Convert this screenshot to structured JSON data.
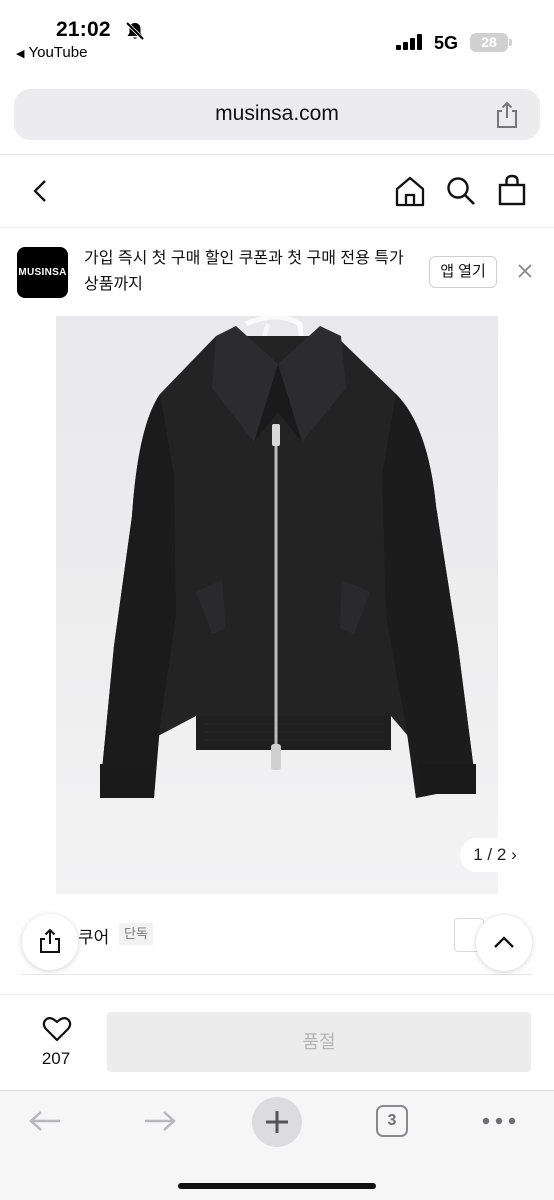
{
  "status_bar": {
    "time": "21:02",
    "back_app": "YouTube",
    "network": "5G",
    "battery": "28",
    "icons": [
      "bell-slash-icon",
      "signal-icon"
    ]
  },
  "browser": {
    "url": "musinsa.com"
  },
  "site_header": {
    "icons": [
      "back-chevron-icon",
      "home-icon",
      "search-icon",
      "shopping-bag-icon"
    ]
  },
  "app_banner": {
    "logo_text": "MUSINSA",
    "message": "가입 즉시 첫 구매 할인 쿠폰과 첫 구매 전용 특가 상품까지",
    "open_button": "앱 열기"
  },
  "product": {
    "image_description_icon": "jacket-image",
    "counter": "1 / 2",
    "brand": "쿠어",
    "tag": "단독"
  },
  "buy_bar": {
    "like_count": "207",
    "soldout_label": "품절"
  },
  "safari_toolbar": {
    "tab_count": "3"
  }
}
